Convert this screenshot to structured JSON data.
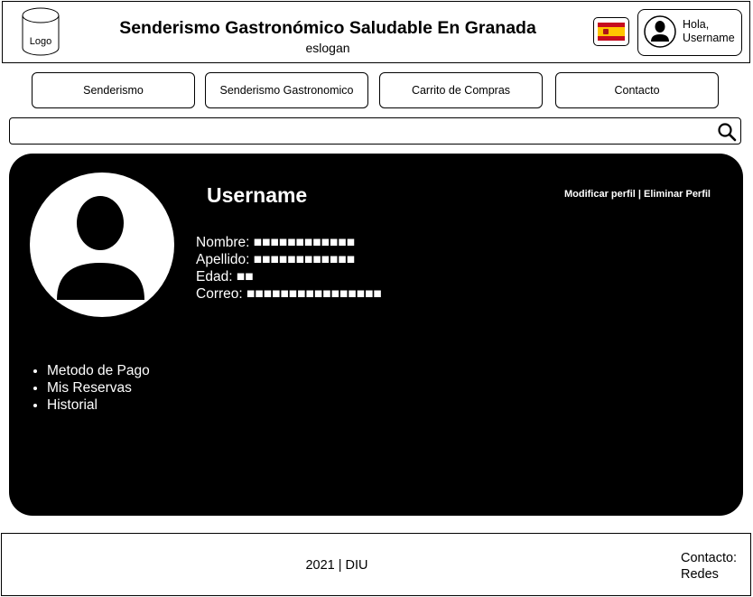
{
  "header": {
    "logo_label": "Logo",
    "title": "Senderismo Gastronómico Saludable En Granada",
    "slogan": "eslogan",
    "flag_icon": "spain-flag-icon",
    "user_greeting_line1": "Hola,",
    "user_greeting_line2": "Username"
  },
  "nav": {
    "items": [
      {
        "label": "Senderismo"
      },
      {
        "label": "Senderismo Gastronomico"
      },
      {
        "label": "Carrito de Compras"
      },
      {
        "label": "Contacto"
      }
    ]
  },
  "search": {
    "value": "",
    "placeholder": "",
    "icon": "search-icon"
  },
  "profile": {
    "username": "Username",
    "edit_label": "Modificar perfil",
    "separator": " | ",
    "delete_label": "Eliminar Perfil",
    "fields": [
      {
        "label": "Nombre:",
        "value": "■■■■■■■■■■■■"
      },
      {
        "label": "Apellido:",
        "value": "■■■■■■■■■■■■"
      },
      {
        "label": "Edad:",
        "value": "■■"
      },
      {
        "label": "Correo:",
        "value": "■■■■■■■■■■■■■■■■"
      }
    ],
    "menu": [
      {
        "label": "Metodo de Pago"
      },
      {
        "label": "Mis Reservas"
      },
      {
        "label": "Historial"
      }
    ]
  },
  "footer": {
    "copyright": "2021 | DIU",
    "contact_line1": "Contacto:",
    "contact_line2": "Redes"
  },
  "colors": {
    "panel_background": "#000000",
    "panel_text": "#ffffff",
    "border": "#000000"
  }
}
